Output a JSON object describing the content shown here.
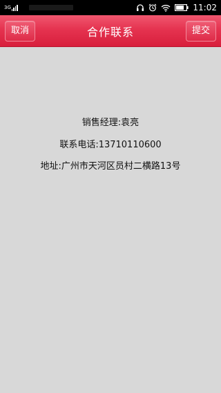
{
  "status_bar": {
    "network": "3G",
    "time": "11:02",
    "icons": [
      "headphones-icon",
      "alarm-icon",
      "wifi-icon",
      "battery-icon"
    ]
  },
  "header": {
    "title": "合作联系",
    "left_button": "取消",
    "right_button": "提交",
    "accent_color": "#e53350"
  },
  "content": {
    "manager": "销售经理:袁亮",
    "phone": "联系电话:13710110600",
    "address": "地址:广州市天河区员村二横路13号"
  }
}
